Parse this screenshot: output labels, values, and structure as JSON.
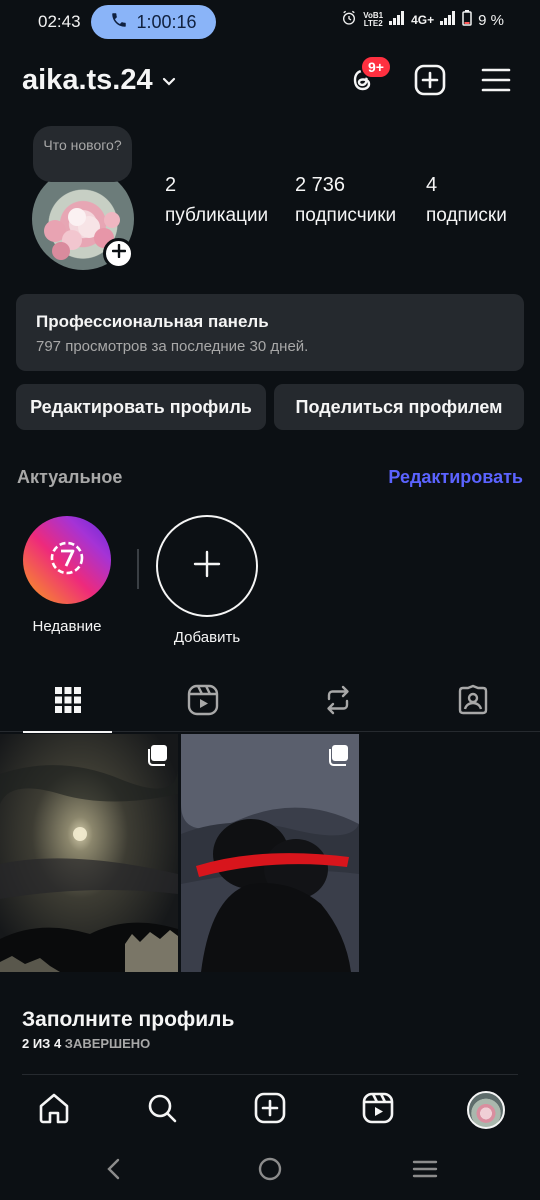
{
  "status_bar": {
    "time": "02:43",
    "call_timer": "1:00:16",
    "volte": "VoB1",
    "lte": "LTE2",
    "network": "4G+",
    "battery": "9 %"
  },
  "header": {
    "username": "aika.ts.24",
    "threads_badge": "9+"
  },
  "profile": {
    "note_text": "Что нового?",
    "stats": [
      {
        "value": "2",
        "label": "публикации"
      },
      {
        "value": "2 736",
        "label": "подписчики"
      },
      {
        "value": "4",
        "label": "подписки"
      }
    ]
  },
  "pro_panel": {
    "title": "Профессиональная панель",
    "subtitle": "797 просмотров за последние 30 дней."
  },
  "buttons": {
    "edit_profile": "Редактировать профиль",
    "share_profile": "Поделиться профилем"
  },
  "highlights": {
    "title": "Актуальное",
    "edit_label": "Редактировать",
    "items": [
      {
        "label": "Недавние",
        "icon": "recent-7-icon"
      },
      {
        "label": "Добавить",
        "icon": "plus-icon"
      }
    ]
  },
  "tabs": [
    "grid-icon",
    "reels-icon",
    "reposts-icon",
    "tagged-icon"
  ],
  "complete_profile": {
    "title": "Заполните профиль",
    "progress_strong": "2 ИЗ 4",
    "progress_rest": "ЗАВЕРШЕНО"
  },
  "bottom_nav": [
    "home-icon",
    "search-icon",
    "create-icon",
    "reels-icon",
    "profile-avatar"
  ],
  "colors": {
    "background": "#0c1014",
    "card": "#25292e",
    "accent_link": "#5b63ff",
    "badge": "#ff3040",
    "call_pill": "#8ab4f8"
  }
}
